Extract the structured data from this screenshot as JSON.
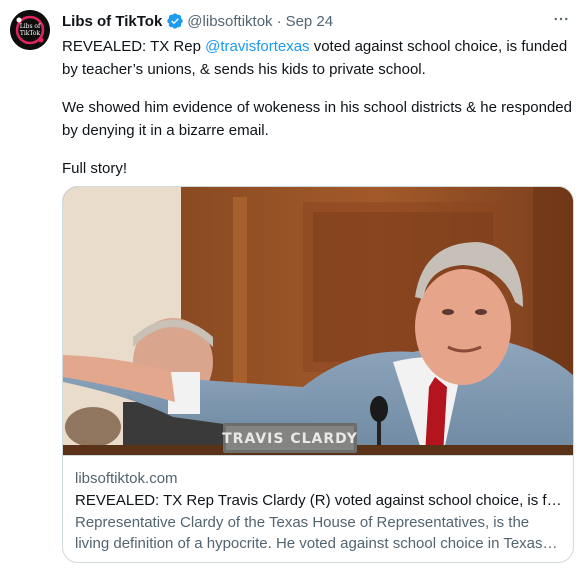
{
  "author": {
    "display_name": "Libs of TikTok",
    "handle": "@libsoftiktok",
    "separator": "·",
    "date": "Sep 24",
    "avatar_text": [
      "Libs of",
      "TikTok"
    ],
    "verified_color": "#1d9bf0"
  },
  "more_icon": "three-dots-icon",
  "tweet": {
    "line1_prefix": "REVEALED: TX Rep ",
    "mention": "@travisfortexas",
    "line1_suffix": " voted against school choice, is funded by teacher’s unions, & sends his kids to private school.",
    "paragraph2": "We showed him evidence of wokeness in his school districts & he responded by denying it in a bizarre email.",
    "paragraph3": "Full story!"
  },
  "card": {
    "domain": "libsoftiktok.com",
    "title": "REVEALED: TX Rep Travis Clardy (R) voted against school choice, is funded by teacher’s unions, & sends his kids to private school.",
    "description": "Representative Clardy of the Texas House of Representatives, is the living definition of a hypocrite. He voted against school choice in Texas and sends his kids to private school.",
    "image_nameplate": "TRAVIS CLARDY"
  },
  "colors": {
    "text": "#0f1419",
    "secondary": "#536471",
    "link": "#1d9bf0",
    "border": "#cfd9de"
  }
}
